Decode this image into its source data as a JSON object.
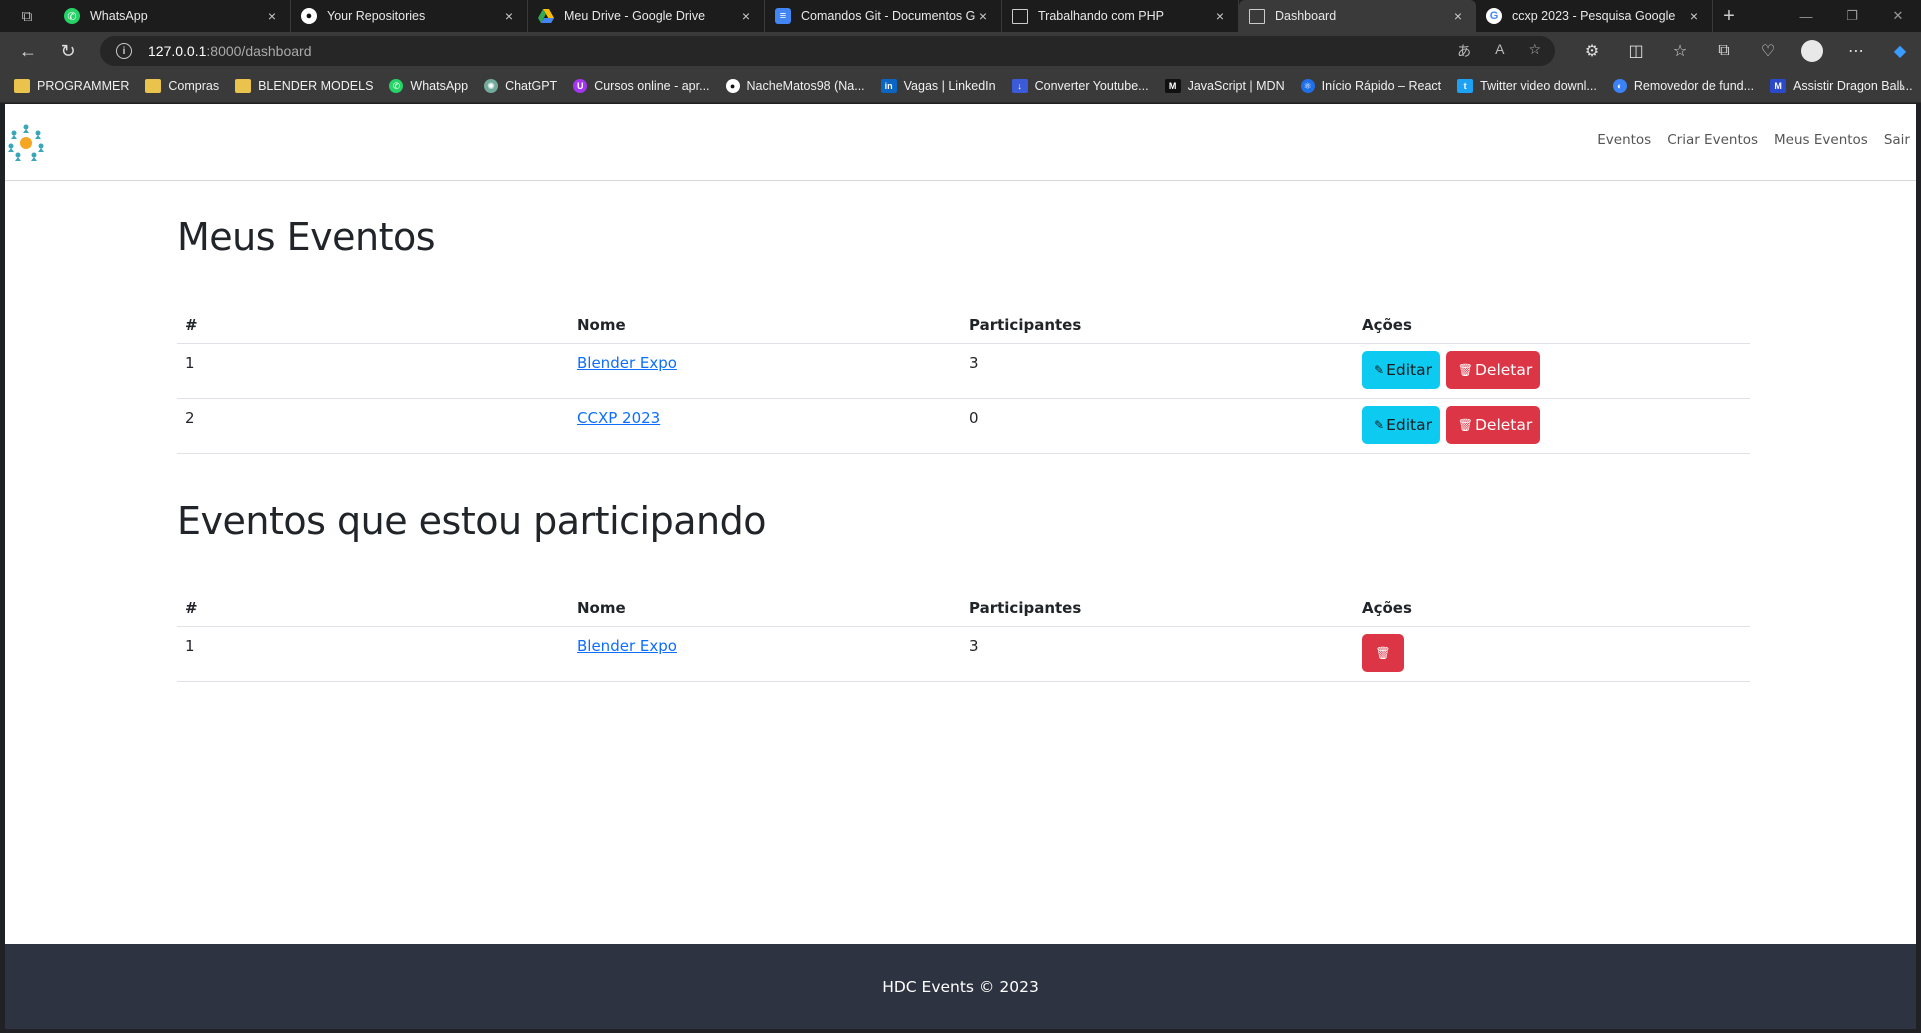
{
  "browser": {
    "tabs": [
      {
        "label": "WhatsApp",
        "icon": "whatsapp-icon",
        "color": "#25d366",
        "active": false
      },
      {
        "label": "Your Repositories",
        "icon": "github-icon",
        "color": "#ffffff",
        "active": false
      },
      {
        "label": "Meu Drive - Google Drive",
        "icon": "google-drive-icon",
        "color": "#34a853",
        "active": false
      },
      {
        "label": "Comandos Git - Documentos Go",
        "icon": "google-docs-icon",
        "color": "#4285f4",
        "active": false
      },
      {
        "label": "Trabalhando com PHP",
        "icon": "page-icon",
        "color": "#cccccc",
        "active": false
      },
      {
        "label": "Dashboard",
        "icon": "page-icon",
        "color": "#cccccc",
        "active": true
      },
      {
        "label": "ccxp 2023 - Pesquisa Google",
        "icon": "google-icon",
        "color": "#ea4335",
        "active": false
      }
    ],
    "close_glyph": "×",
    "new_tab_glyph": "+",
    "url_host": "127.0.0.1",
    "url_path": ":8000/dashboard",
    "bookmarks": [
      {
        "label": "PROGRAMMER",
        "icon": "folder-icon",
        "color": "#e9c34b"
      },
      {
        "label": "Compras",
        "icon": "folder-icon",
        "color": "#e9c34b"
      },
      {
        "label": "BLENDER MODELS",
        "icon": "folder-icon",
        "color": "#e9c34b"
      },
      {
        "label": "WhatsApp",
        "icon": "whatsapp-icon",
        "color": "#25d366"
      },
      {
        "label": "ChatGPT",
        "icon": "chatgpt-icon",
        "color": "#74aa9c"
      },
      {
        "label": "Cursos online - apr...",
        "icon": "udemy-icon",
        "color": "#a435f0"
      },
      {
        "label": "NacheMatos98 (Na...",
        "icon": "github-icon",
        "color": "#333333"
      },
      {
        "label": "Vagas | LinkedIn",
        "icon": "linkedin-icon",
        "color": "#0a66c2"
      },
      {
        "label": "Converter Youtube...",
        "icon": "download-icon",
        "color": "#3b5bdb"
      },
      {
        "label": "JavaScript | MDN",
        "icon": "mdn-icon",
        "color": "#111111"
      },
      {
        "label": "Início Rápido – React",
        "icon": "react-icon",
        "color": "#1f6feb"
      },
      {
        "label": "Twitter video downl...",
        "icon": "twitter-icon",
        "color": "#1da1f2"
      },
      {
        "label": "Removedor de fund...",
        "icon": "removebg-icon",
        "color": "#3b82f6"
      },
      {
        "label": "Assistir Dragon Ball...",
        "icon": "animes-icon",
        "color": "#2b4acb"
      }
    ]
  },
  "site": {
    "nav": [
      "Eventos",
      "Criar Eventos",
      "Meus Eventos",
      "Sair"
    ],
    "my_events_title": "Meus Eventos",
    "participating_title": "Eventos que estou participando",
    "columns": {
      "num": "#",
      "name": "Nome",
      "participants": "Participantes",
      "actions": "Ações"
    },
    "my_events": [
      {
        "num": "1",
        "name": "Blender Expo",
        "participants": "3"
      },
      {
        "num": "2",
        "name": "CCXP 2023",
        "participants": "0"
      }
    ],
    "participating_events": [
      {
        "num": "1",
        "name": "Blender Expo",
        "participants": "3"
      }
    ],
    "edit_label": "Editar",
    "delete_label": "Deletar",
    "footer": "HDC Events © 2023",
    "colors": {
      "info": "#0dcaf0",
      "danger": "#dc3545",
      "footer_bg": "#2d3340",
      "link": "#0d6efd"
    }
  }
}
